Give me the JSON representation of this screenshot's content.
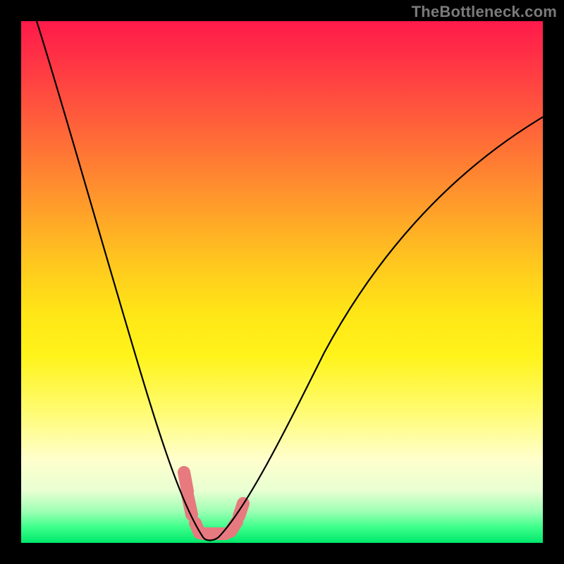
{
  "watermark": "TheBottleneck.com",
  "chart_data": {
    "type": "line",
    "title": "",
    "xlabel": "",
    "ylabel": "",
    "xlim": [
      0,
      100
    ],
    "ylim": [
      0,
      100
    ],
    "grid": false,
    "series": [
      {
        "name": "bottleneck-curve",
        "x": [
          3,
          6,
          9,
          12,
          15,
          18,
          21,
          24,
          26,
          28,
          30,
          31.5,
          33,
          34,
          35,
          36,
          37,
          39,
          42,
          46,
          50,
          55,
          60,
          66,
          72,
          80,
          90,
          100
        ],
        "y": [
          100,
          88,
          76,
          65,
          55,
          45,
          36,
          28,
          22,
          16,
          11,
          7,
          4,
          2,
          1,
          0.5,
          1,
          3,
          7,
          14,
          22,
          31,
          40,
          49,
          57,
          66,
          75,
          82
        ]
      }
    ],
    "markers": {
      "name": "optimal-zone",
      "x_range": [
        31,
        40
      ],
      "color": "#e77a7f"
    },
    "gradient_stops": [
      {
        "pos": 0,
        "color": "#ff1a4a"
      },
      {
        "pos": 46,
        "color": "#ffc61f"
      },
      {
        "pos": 64,
        "color": "#fff31a"
      },
      {
        "pos": 100,
        "color": "#00e86b"
      }
    ]
  }
}
